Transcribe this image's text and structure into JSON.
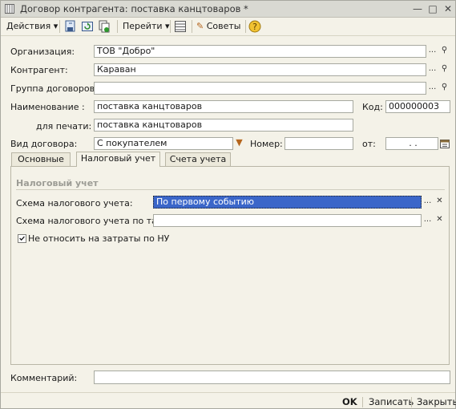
{
  "window": {
    "title": "Договор контрагента: поставка канцтоваров *"
  },
  "toolbar": {
    "actions_label": "Действия",
    "goto_label": "Перейти",
    "tips_label": "Советы"
  },
  "form": {
    "organization": {
      "label": "Организация:",
      "value": "ТОВ \"Добро\""
    },
    "counterparty": {
      "label": "Контрагент:",
      "value": "Караван"
    },
    "contract_group": {
      "label": "Группа договоров:",
      "value": ""
    },
    "name": {
      "label": "Наименование :",
      "value": "поставка канцтоваров"
    },
    "code": {
      "label": "Код:",
      "value": "000000003"
    },
    "print_name": {
      "label": "для печати:",
      "value": "поставка канцтоваров"
    },
    "contract_type": {
      "label": "Вид договора:",
      "value": "С покупателем"
    },
    "number": {
      "label": "Номер:",
      "value": ""
    },
    "date": {
      "label": "от:",
      "value": " .  . "
    }
  },
  "tabs": [
    {
      "label": "Основные",
      "active": false
    },
    {
      "label": "Налоговый учет",
      "active": true
    },
    {
      "label": "Счета учета",
      "active": false
    }
  ],
  "tax_tab": {
    "section_title": "Налоговый учет",
    "scheme": {
      "label": "Схема налогового учета:",
      "value": "По первому событию"
    },
    "scheme_tare": {
      "label": "Схема налогового учета по таре:",
      "value": ""
    },
    "not_expenses": {
      "label": "Не относить на затраты по НУ",
      "checked": true
    }
  },
  "comment": {
    "label": "Комментарий:",
    "value": ""
  },
  "bottom": {
    "ok": "OK",
    "save": "Записать",
    "close": "Закрыть"
  },
  "colors": {
    "selection": "#3b66c9",
    "window_bg": "#f4f2e8"
  }
}
